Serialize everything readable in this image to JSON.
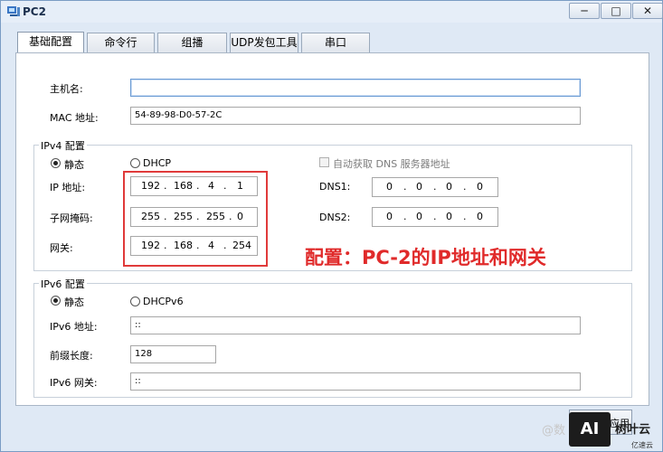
{
  "window": {
    "title": "PC2",
    "controls": [
      "─",
      "□",
      "✕"
    ]
  },
  "tabs": [
    "基础配置",
    "命令行",
    "组播",
    "UDP发包工具",
    "串口"
  ],
  "basic": {
    "hostname_label": "主机名:",
    "hostname_value": "",
    "mac_label": "MAC 地址:",
    "mac_value": "54-89-98-D0-57-2C"
  },
  "ipv4": {
    "group_title": "IPv4 配置",
    "static_label": "静态",
    "dhcp_label": "DHCP",
    "auto_dns_label": "自动获取 DNS 服务器地址",
    "ip_label": "IP 地址:",
    "ip": [
      "192",
      "168",
      "4",
      "1"
    ],
    "mask_label": "子网掩码:",
    "mask": [
      "255",
      "255",
      "255",
      "0"
    ],
    "gateway_label": "网关:",
    "gateway": [
      "192",
      "168",
      "4",
      "254"
    ],
    "dns1_label": "DNS1:",
    "dns1": [
      "0",
      "0",
      "0",
      "0"
    ],
    "dns2_label": "DNS2:",
    "dns2": [
      "0",
      "0",
      "0",
      "0"
    ]
  },
  "ipv6": {
    "group_title": "IPv6 配置",
    "static_label": "静态",
    "dhcp_label": "DHCPv6",
    "ip_label": "IPv6 地址:",
    "ip_value": "::",
    "prefix_label": "前缀长度:",
    "prefix_value": "128",
    "gateway_label": "IPv6 网关:",
    "gateway_value": "::"
  },
  "annotation": {
    "text": "配置：PC-2的IP地址和网关",
    "color": "#e02a2a"
  },
  "watermark": {
    "logo": "AI",
    "name": "树叶云",
    "sub": "亿速云",
    "faint": "@数"
  },
  "bottom_button": {
    "label": "应用"
  }
}
